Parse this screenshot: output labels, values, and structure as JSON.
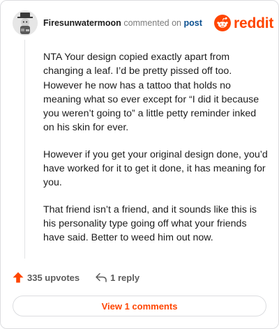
{
  "comment": {
    "username": "Firesunwatermoon",
    "action_text": "commented on",
    "post_link_text": "post",
    "paragraphs": [
      "NTA Your design copied exactly apart from changing a leaf. I’d be pretty pissed off too. However he now has a tattoo that holds no meaning what so ever except for “I did it because you weren’t going to” a little petty reminder inked on his skin for ever.",
      "However if you get your original design done, you’d have worked for it to get it done, it has meaning for you.",
      "That friend isn’t a friend, and it sounds like this is his personality type going off what your friends have said. Better to weed him out now."
    ],
    "upvotes_label": "335 upvotes",
    "reply_label": "1 reply",
    "view_comments_label": "View 1 comments"
  },
  "brand": {
    "logo_text": "reddit",
    "accent_color": "#ff4500",
    "link_color": "#0a4f8f"
  },
  "icons": {
    "avatar": "avatar-cat-hat",
    "logo": "reddit-snoo-icon",
    "upvote": "upvote-arrow-icon",
    "reply": "reply-arrow-icon"
  }
}
